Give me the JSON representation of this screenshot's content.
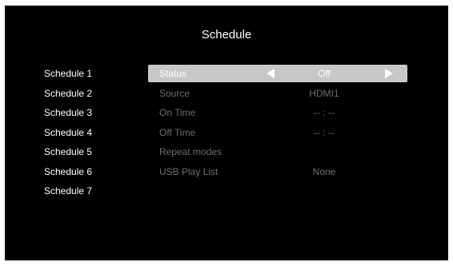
{
  "title": "Schedule",
  "schedules": [
    "Schedule 1",
    "Schedule 2",
    "Schedule 3",
    "Schedule 4",
    "Schedule 5",
    "Schedule 6",
    "Schedule 7"
  ],
  "settings": {
    "status": {
      "label": "Status",
      "value": "Off"
    },
    "source": {
      "label": "Source",
      "value": "HDMI1"
    },
    "on_time": {
      "label": "On Time",
      "value": "-- : --"
    },
    "off_time": {
      "label": "Off Time",
      "value": "-- : --"
    },
    "repeat_modes": {
      "label": "Repeat modes",
      "value": ""
    },
    "usb_play_list": {
      "label": "USB Play List",
      "value": "None"
    }
  },
  "icons": {
    "left": "triangle-left-icon",
    "right": "triangle-right-icon"
  },
  "colors": {
    "background": "#000000",
    "highlight": "#c7c7c7",
    "disabled_text": "#6d6d6d",
    "text": "#ffffff"
  }
}
